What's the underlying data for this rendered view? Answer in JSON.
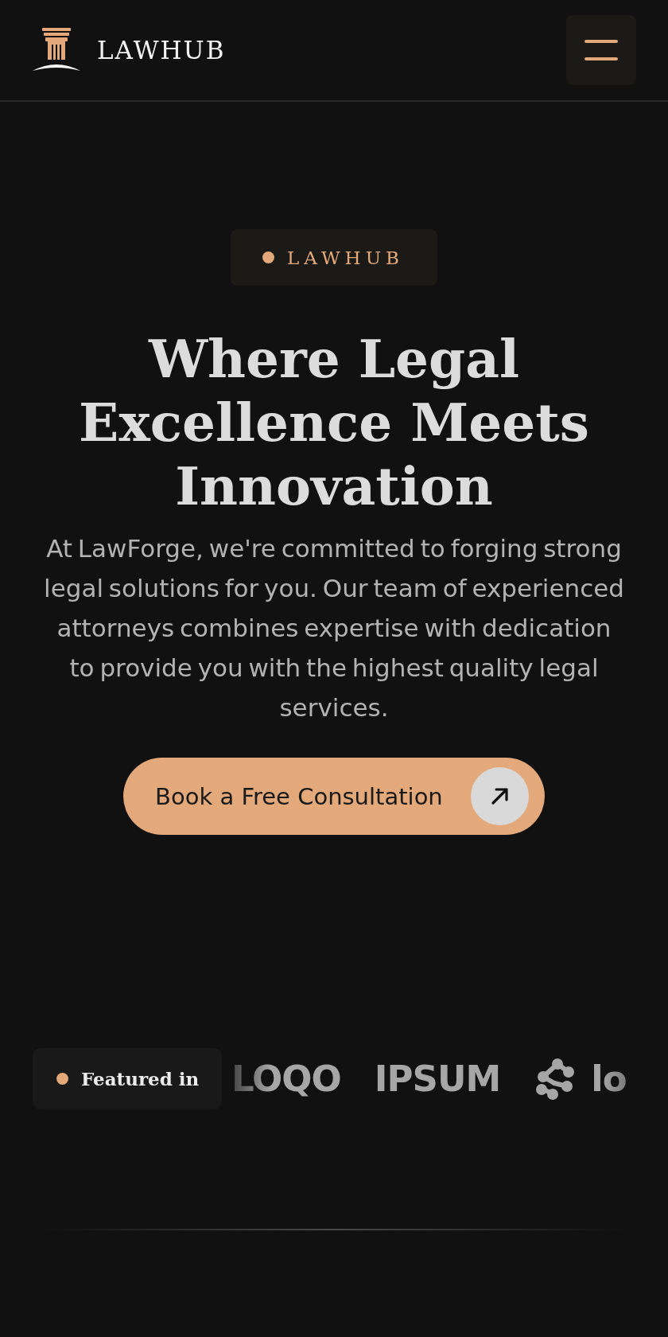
{
  "header": {
    "brand": "LAWHUB"
  },
  "hero": {
    "badge": "LAWHUB",
    "title": "Where Legal Excellence Meets Innovation",
    "description": "At LawForge, we're committed to forging strong legal solutions for you. Our team of experienced attorneys combines expertise with dedication to provide you with the highest quality legal services.",
    "cta": "Book a Free Consultation"
  },
  "featured": {
    "label": "Featured in",
    "logos": [
      {
        "kind": "wordmark",
        "text": "LOQO"
      },
      {
        "kind": "wordmark",
        "text": "IPSUM"
      },
      {
        "kind": "symbol",
        "text": "lo"
      }
    ]
  }
}
